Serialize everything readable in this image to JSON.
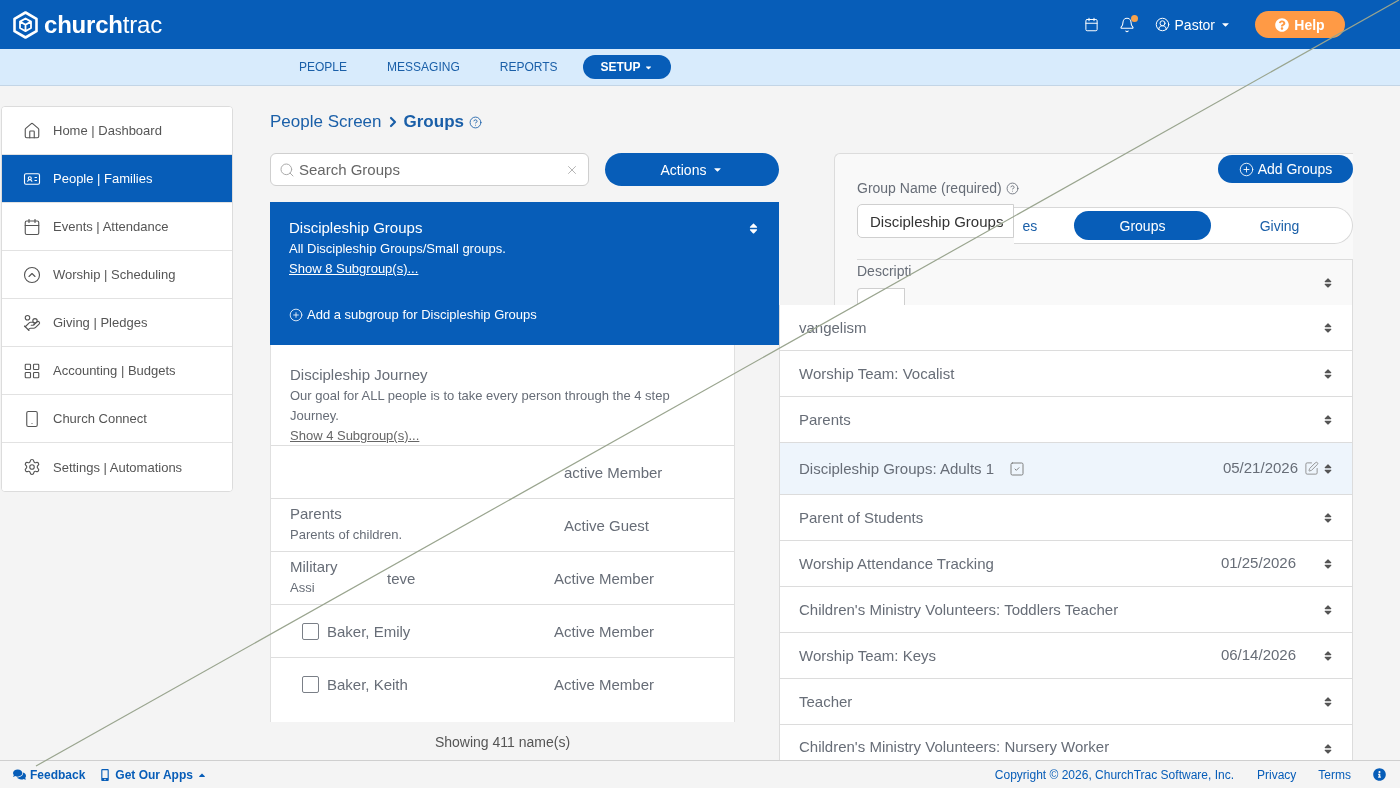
{
  "header": {
    "logo": "**church**trac",
    "notification_dot": true,
    "user": "Pastor",
    "help": "Help"
  },
  "nav": [
    {
      "label": "PEOPLE",
      "selected": false
    },
    {
      "label": "MESSAGING",
      "selected": false
    },
    {
      "label": "REPORTS",
      "selected": false
    },
    {
      "label": "SETUP",
      "selected": true
    }
  ],
  "sidebar": {
    "items": [
      {
        "label": "Home | Dashboard",
        "selected": false
      },
      {
        "label": "People | Families",
        "selected": true
      },
      {
        "label": "Events | Attendance",
        "selected": false
      },
      {
        "label": "Worship | Scheduling",
        "selected": false
      },
      {
        "label": "Giving | Pledges",
        "selected": false
      },
      {
        "label": "Accounting | Budgets",
        "selected": false
      },
      {
        "label": "Church Connect",
        "selected": false
      },
      {
        "label": "Settings | Automations",
        "selected": false
      }
    ]
  },
  "breadcrumb": {
    "parent": "People Screen",
    "current": "Groups"
  },
  "search": {
    "placeholder": "Search Groups"
  },
  "actions_button": "Actions",
  "group_list": [
    {
      "title": "Discipleship Groups",
      "description": "All Discipleship Groups/Small groups.",
      "link": "Show 8 Subgroup(s)...",
      "add_subgroup": "Add a subgroup for Discipleship Groups",
      "selected": true
    },
    {
      "title": "Discipleship Journey",
      "description": "Our goal for ALL people is to take every person through the 4 step\nJourney.",
      "link": "Show 4 Subgroup(s)...",
      "selected": false
    },
    {
      "title": "Parents",
      "description": "Parents of children.",
      "selected": false
    },
    {
      "title": "Military",
      "description": "Assi",
      "selected": false
    }
  ],
  "member_list": {
    "rows": [
      {
        "status": "active Member"
      },
      {
        "status": "Active Guest"
      },
      {
        "name": "teve",
        "status": "Active Member"
      },
      {
        "name": "Baker, Emily",
        "status": "Active Member",
        "checked": false
      },
      {
        "name": "Baker, Keith",
        "status": "Active Member",
        "checked": false
      }
    ],
    "count": "Showing 411 name(s)"
  },
  "group_form": {
    "label": "Group Name (required)",
    "value": "Discipleship Groups",
    "description_label": "Descripti"
  },
  "add_groups_button": "Add Groups",
  "tabs": [
    {
      "label": "es",
      "selected": false
    },
    {
      "label": "Groups",
      "selected": true
    },
    {
      "label": "Giving",
      "selected": false
    }
  ],
  "group_rows": [
    {
      "name": "vangelism",
      "selected": false
    },
    {
      "name": "Worship Team: Vocalist",
      "selected": false
    },
    {
      "name": "Parents",
      "selected": false
    },
    {
      "name": "Discipleship Groups: Adults 1",
      "checked": true,
      "date": "05/21/2026",
      "selected": true
    },
    {
      "name": "Parent of Students",
      "selected": false
    },
    {
      "name": "Worship Attendance Tracking",
      "date": "01/25/2026",
      "selected": false
    },
    {
      "name": "Children's Ministry Volunteers: Toddlers Teacher",
      "selected": false
    },
    {
      "name": "Worship Team: Keys",
      "date": "06/14/2026",
      "selected": false
    },
    {
      "name": "Teacher",
      "selected": false
    },
    {
      "name": "Children's Ministry Volunteers: Nursery Worker",
      "selected": false
    }
  ],
  "footer": {
    "feedback": "Feedback",
    "apps": "Get Our Apps",
    "copyright": "Copyright © 2026, ChurchTrac Software, Inc.",
    "links": [
      "Privacy",
      "Terms"
    ]
  }
}
